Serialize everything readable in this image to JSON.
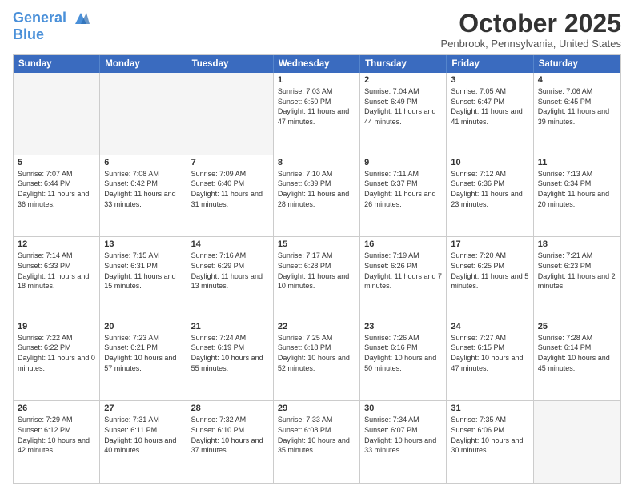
{
  "header": {
    "logo_line1": "General",
    "logo_line2": "Blue",
    "month": "October 2025",
    "location": "Penbrook, Pennsylvania, United States"
  },
  "days": [
    "Sunday",
    "Monday",
    "Tuesday",
    "Wednesday",
    "Thursday",
    "Friday",
    "Saturday"
  ],
  "rows": [
    [
      {
        "date": "",
        "empty": true
      },
      {
        "date": "",
        "empty": true
      },
      {
        "date": "",
        "empty": true
      },
      {
        "date": "1",
        "sunrise": "7:03 AM",
        "sunset": "6:50 PM",
        "daylight": "11 hours and 47 minutes."
      },
      {
        "date": "2",
        "sunrise": "7:04 AM",
        "sunset": "6:49 PM",
        "daylight": "11 hours and 44 minutes."
      },
      {
        "date": "3",
        "sunrise": "7:05 AM",
        "sunset": "6:47 PM",
        "daylight": "11 hours and 41 minutes."
      },
      {
        "date": "4",
        "sunrise": "7:06 AM",
        "sunset": "6:45 PM",
        "daylight": "11 hours and 39 minutes."
      }
    ],
    [
      {
        "date": "5",
        "sunrise": "7:07 AM",
        "sunset": "6:44 PM",
        "daylight": "11 hours and 36 minutes."
      },
      {
        "date": "6",
        "sunrise": "7:08 AM",
        "sunset": "6:42 PM",
        "daylight": "11 hours and 33 minutes."
      },
      {
        "date": "7",
        "sunrise": "7:09 AM",
        "sunset": "6:40 PM",
        "daylight": "11 hours and 31 minutes."
      },
      {
        "date": "8",
        "sunrise": "7:10 AM",
        "sunset": "6:39 PM",
        "daylight": "11 hours and 28 minutes."
      },
      {
        "date": "9",
        "sunrise": "7:11 AM",
        "sunset": "6:37 PM",
        "daylight": "11 hours and 26 minutes."
      },
      {
        "date": "10",
        "sunrise": "7:12 AM",
        "sunset": "6:36 PM",
        "daylight": "11 hours and 23 minutes."
      },
      {
        "date": "11",
        "sunrise": "7:13 AM",
        "sunset": "6:34 PM",
        "daylight": "11 hours and 20 minutes."
      }
    ],
    [
      {
        "date": "12",
        "sunrise": "7:14 AM",
        "sunset": "6:33 PM",
        "daylight": "11 hours and 18 minutes."
      },
      {
        "date": "13",
        "sunrise": "7:15 AM",
        "sunset": "6:31 PM",
        "daylight": "11 hours and 15 minutes."
      },
      {
        "date": "14",
        "sunrise": "7:16 AM",
        "sunset": "6:29 PM",
        "daylight": "11 hours and 13 minutes."
      },
      {
        "date": "15",
        "sunrise": "7:17 AM",
        "sunset": "6:28 PM",
        "daylight": "11 hours and 10 minutes."
      },
      {
        "date": "16",
        "sunrise": "7:19 AM",
        "sunset": "6:26 PM",
        "daylight": "11 hours and 7 minutes."
      },
      {
        "date": "17",
        "sunrise": "7:20 AM",
        "sunset": "6:25 PM",
        "daylight": "11 hours and 5 minutes."
      },
      {
        "date": "18",
        "sunrise": "7:21 AM",
        "sunset": "6:23 PM",
        "daylight": "11 hours and 2 minutes."
      }
    ],
    [
      {
        "date": "19",
        "sunrise": "7:22 AM",
        "sunset": "6:22 PM",
        "daylight": "11 hours and 0 minutes."
      },
      {
        "date": "20",
        "sunrise": "7:23 AM",
        "sunset": "6:21 PM",
        "daylight": "10 hours and 57 minutes."
      },
      {
        "date": "21",
        "sunrise": "7:24 AM",
        "sunset": "6:19 PM",
        "daylight": "10 hours and 55 minutes."
      },
      {
        "date": "22",
        "sunrise": "7:25 AM",
        "sunset": "6:18 PM",
        "daylight": "10 hours and 52 minutes."
      },
      {
        "date": "23",
        "sunrise": "7:26 AM",
        "sunset": "6:16 PM",
        "daylight": "10 hours and 50 minutes."
      },
      {
        "date": "24",
        "sunrise": "7:27 AM",
        "sunset": "6:15 PM",
        "daylight": "10 hours and 47 minutes."
      },
      {
        "date": "25",
        "sunrise": "7:28 AM",
        "sunset": "6:14 PM",
        "daylight": "10 hours and 45 minutes."
      }
    ],
    [
      {
        "date": "26",
        "sunrise": "7:29 AM",
        "sunset": "6:12 PM",
        "daylight": "10 hours and 42 minutes."
      },
      {
        "date": "27",
        "sunrise": "7:31 AM",
        "sunset": "6:11 PM",
        "daylight": "10 hours and 40 minutes."
      },
      {
        "date": "28",
        "sunrise": "7:32 AM",
        "sunset": "6:10 PM",
        "daylight": "10 hours and 37 minutes."
      },
      {
        "date": "29",
        "sunrise": "7:33 AM",
        "sunset": "6:08 PM",
        "daylight": "10 hours and 35 minutes."
      },
      {
        "date": "30",
        "sunrise": "7:34 AM",
        "sunset": "6:07 PM",
        "daylight": "10 hours and 33 minutes."
      },
      {
        "date": "31",
        "sunrise": "7:35 AM",
        "sunset": "6:06 PM",
        "daylight": "10 hours and 30 minutes."
      },
      {
        "date": "",
        "empty": true
      }
    ]
  ]
}
